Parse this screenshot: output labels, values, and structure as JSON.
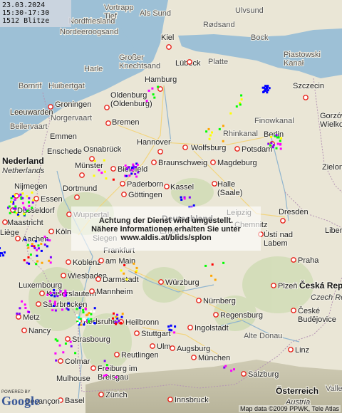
{
  "info": {
    "date": "23.03.2024",
    "time_range": "15:30-17:30",
    "strike_count": "1512 Blitze"
  },
  "notice": {
    "line1": "Achtung der Dienst wird umgestellt.",
    "line2": "Nähere Informationen erhalten Sie unter",
    "line3": "www.aldis.at/blids/splon"
  },
  "logo": {
    "powered_by": "POWERED BY",
    "name": "Google"
  },
  "copyright": "Map data ©2009 PPWK, Tele Atlas",
  "labels": {
    "vortrapp_tief": "Vortrapp\nTief",
    "als_sund": "Als Sund",
    "ulvsund": "Ulvsund",
    "nordfriesland": "Nordfriesland",
    "nordeeroogsand": "Nordeeroogsand",
    "rodsand": "Rødsand",
    "kiel": "Kiel",
    "bock": "Bock",
    "grosser_knechtsand": "Großer\nKnechtsand",
    "lubeck": "Lübeck",
    "platte": "Platte",
    "piastowski_kanal": "Piastowski\nKanał",
    "harle": "Harle",
    "hamburg": "Hamburg",
    "bornrif": "Bornrif",
    "huibertgat": "Huibertgat",
    "szczecin": "Szczecin",
    "groningen": "Groningen",
    "oldenburg": "Oldenburg\n(Oldenburg)",
    "leeuwarden": "Leeuwarden",
    "norgervaart": "Norgervaart",
    "finowkanal": "Finowkanal",
    "gorzow": "Gorzów\nWielkopolski",
    "bremen": "Bremen",
    "beilervaart": "Beilervaart",
    "emmen": "Emmen",
    "rhinkanal": "Rhinkanal",
    "berlin": "Berlin",
    "hannover": "Hannover",
    "wolfsburg": "Wolfsburg",
    "potsdam": "Potsdam",
    "enschede": "Enschede",
    "osnabruck": "Osnabrück",
    "nederland": "Nederland",
    "netherlands": "Netherlands",
    "munster": "Münster",
    "bielefeld": "Bielefeld",
    "braunschweig": "Braunschweig",
    "magdeburg": "Magdeburg",
    "zielona_gora": "Zielona",
    "paderborn": "Paderborn",
    "nijmegen": "Nijmegen",
    "dortmund": "Dortmund",
    "gottingen": "Göttingen",
    "halle": "Halle\n(Saale)",
    "essen": "Essen",
    "kassel": "Kassel",
    "dusseldorf": "Düsseldorf",
    "wuppertal": "Wuppertal",
    "deutschland": "Deutschland",
    "leipzig": "Leipzig",
    "dresden": "Dresden",
    "maastricht": "Maastricht",
    "chemnitz": "Chemnitz",
    "koln": "Köln",
    "siegen": "Siegen",
    "erfurt": "Erfurt",
    "liberec": "Liberec",
    "liege": "Liège",
    "aachen": "Aachen",
    "usti": "Ústí nad\nLabem",
    "frankfurt": "Frankfurt",
    "koblenz": "Koblenz",
    "frankfurt_am_main": "am Main",
    "praha": "Praha",
    "wiesbaden": "Wiesbaden",
    "luxembourg": "Luxembourg",
    "darmstadt": "Darmstadt",
    "wurzburg": "Würzburg",
    "plzen": "Plzeň",
    "ceska": "Česká Rep",
    "czech": "Czech Re",
    "kaiserslautern": "Kaiserslautern",
    "mannheim": "Mannheim",
    "nurnberg": "Nürnberg",
    "saarbrucken": "Saarbrücken",
    "regensburg": "Regensburg",
    "metz": "Metz",
    "karlsruhe": "Karlsruhe",
    "heilbronn": "Heilbronn",
    "ceske": "České\nBudějovice",
    "ingolstadt": "Ingolstadt",
    "nancy": "Nancy",
    "stuttgart": "Stuttgart",
    "alte_donau": "Alte Donau",
    "strasbourg": "Strasbourg",
    "ulm": "Ulm",
    "augsburg": "Augsburg",
    "linz": "Linz",
    "reutlingen": "Reutlingen",
    "munchen": "München",
    "colmar": "Colmar",
    "freiburg": "Freiburg im\nBreisgau",
    "salzburg": "Salzburg",
    "mulhouse": "Mulhouse",
    "basel": "Basel",
    "zurich": "Zürich",
    "innsbruck": "Innsbruck",
    "osterreich": "Österreich",
    "austria": "Austria",
    "besancon": "Besançon",
    "valle_zdnje": "Valle"
  },
  "colors": {
    "water": "#9dc0d6",
    "land": "#eae6d6",
    "forest": "#cfdcb4",
    "city_marker": "#e8231b",
    "strike_colors": [
      "#ffffff",
      "#ffff00",
      "#ffa500",
      "#ff0000",
      "#ff00ff",
      "#8000ff",
      "#0000ff",
      "#00ffff",
      "#00ff00"
    ]
  }
}
